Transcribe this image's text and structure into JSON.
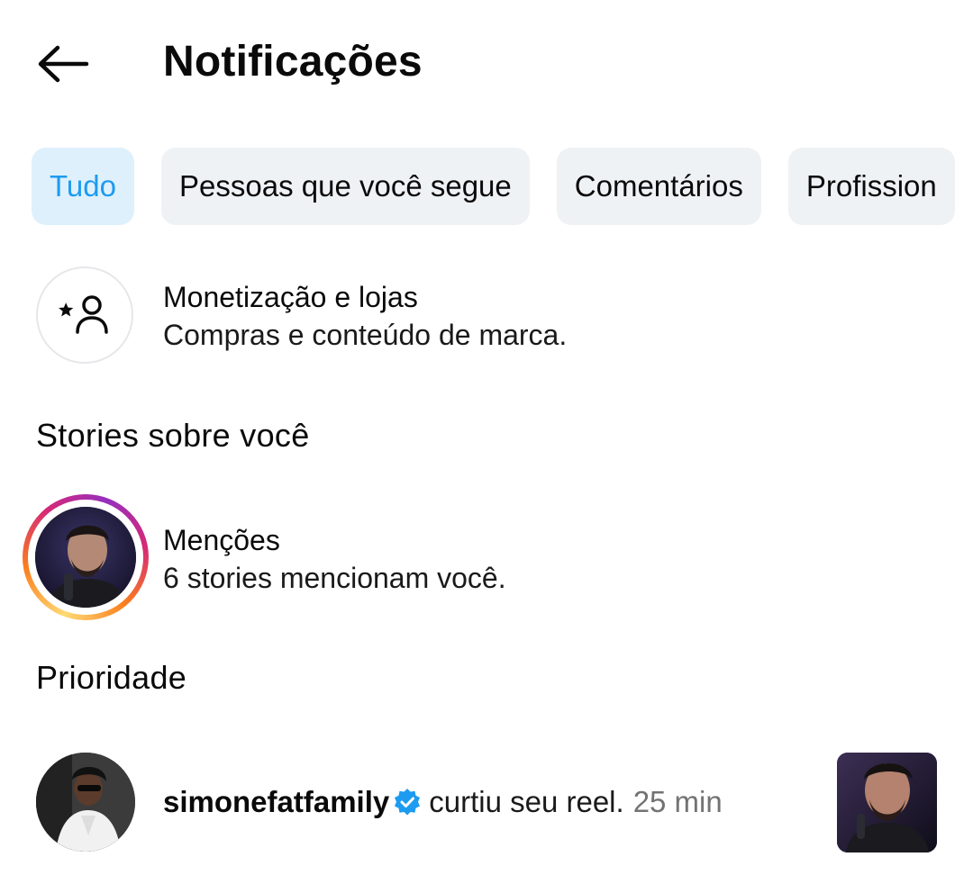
{
  "header": {
    "back_icon": "arrow-left-icon",
    "title": "Notificações"
  },
  "filters": [
    {
      "label": "Tudo",
      "active": true
    },
    {
      "label": "Pessoas que você segue",
      "active": false
    },
    {
      "label": "Comentários",
      "active": false
    },
    {
      "label": "Profission",
      "active": false
    }
  ],
  "monetization": {
    "icon": "person-star-icon",
    "title": "Monetização e lojas",
    "subtitle": "Compras e conteúdo de marca."
  },
  "stories_section": {
    "heading": "Stories sobre você",
    "mentions": {
      "title": "Menções",
      "subtitle": "6 stories mencionam você."
    }
  },
  "priority_section": {
    "heading": "Prioridade",
    "notification": {
      "username": "simonefatfamily",
      "verified": true,
      "action": "curtiu seu reel.",
      "time": "25 min"
    }
  },
  "colors": {
    "accent": "#1d9bf0",
    "chip_bg": "#eff2f5",
    "chip_active_bg": "#dff0fd",
    "muted": "#737373"
  }
}
